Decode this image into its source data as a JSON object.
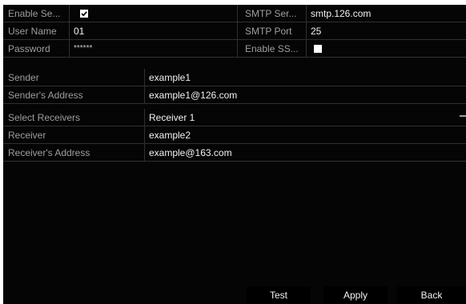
{
  "email": {
    "enable_server_auth_label": "Enable Se...",
    "enable_server_auth_checked": true,
    "smtp_server_label": "SMTP Ser...",
    "smtp_server_value": "smtp.126.com",
    "user_name_label": "User Name",
    "user_name_value": "01",
    "smtp_port_label": "SMTP Port",
    "smtp_port_value": "25",
    "password_label": "Password",
    "password_value": "******",
    "enable_ssl_label": "Enable SS...",
    "enable_ssl_checked": false,
    "sender_label": "Sender",
    "sender_value": "example1",
    "sender_address_label": "Sender's Address",
    "sender_address_value": "example1@126.com",
    "select_receivers_label": "Select Receivers",
    "select_receivers_value": "Receiver 1",
    "receiver_label": "Receiver",
    "receiver_value": "example2",
    "receiver_address_label": "Receiver's Address",
    "receiver_address_value": "example@163.com"
  },
  "buttons": {
    "test": "Test",
    "apply": "Apply",
    "back": "Back"
  },
  "colors": {
    "background": "#050505",
    "label_text": "#9e9e9e",
    "value_text": "#f2f2f2",
    "divider": "#303030"
  }
}
